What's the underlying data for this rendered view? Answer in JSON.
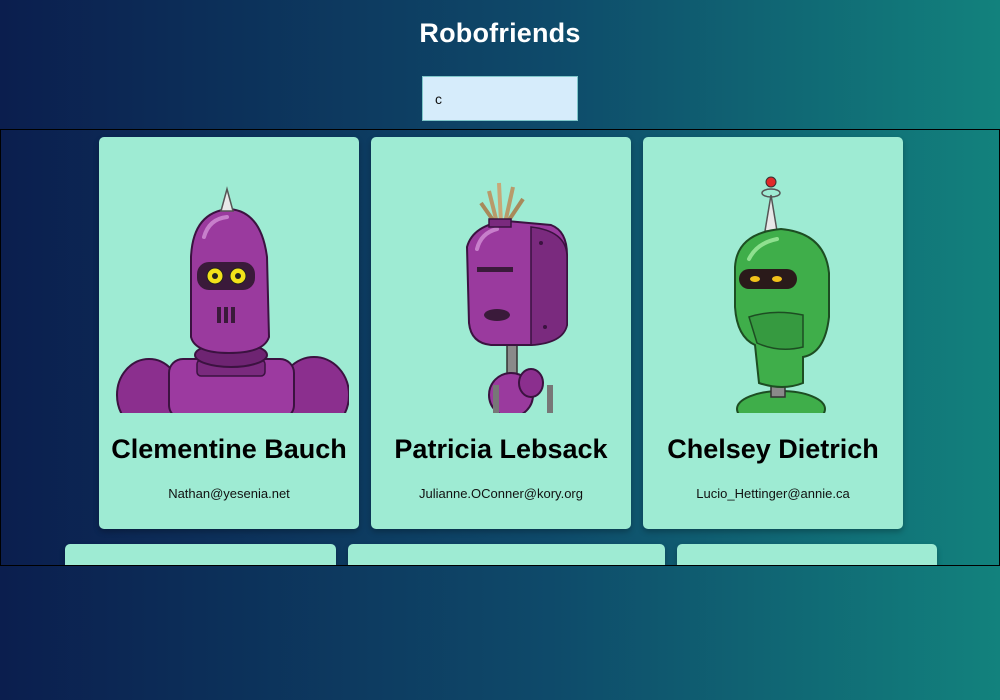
{
  "header": {
    "title": "Robofriends"
  },
  "search": {
    "value": "c"
  },
  "robots": [
    {
      "name": "Clementine Bauch",
      "email": "Nathan@yesenia.net",
      "color": "purple-spike"
    },
    {
      "name": "Patricia Lebsack",
      "email": "Julianne.OConner@kory.org",
      "color": "purple-hair"
    },
    {
      "name": "Chelsey Dietrich",
      "email": "Lucio_Hettinger@annie.ca",
      "color": "green-antenna"
    }
  ],
  "colors": {
    "card": "#9eebd3",
    "search_bg": "#d6ecfb",
    "title": "#ffffff"
  }
}
